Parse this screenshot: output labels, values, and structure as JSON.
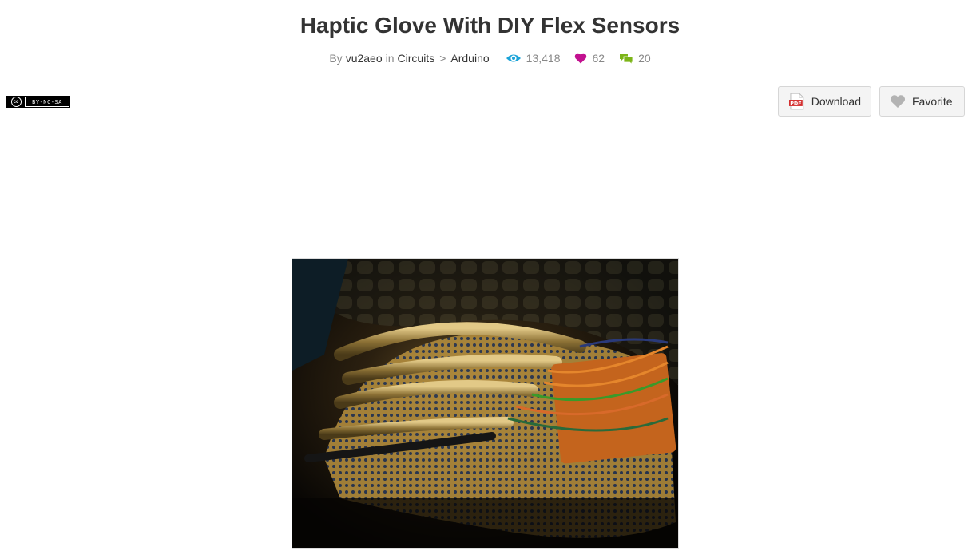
{
  "title": "Haptic Glove With DIY Flex Sensors",
  "meta": {
    "by_label": "By",
    "author": "vu2aeo",
    "in_label": "in",
    "category": "Circuits",
    "separator": ">",
    "subcategory": "Arduino",
    "views": "13,418",
    "favorites": "62",
    "comments": "20"
  },
  "license": {
    "badge": "cc",
    "terms": "BY-NC-SA"
  },
  "actions": {
    "download_label": "Download",
    "favorite_label": "Favorite",
    "pdf_badge": "PDF"
  },
  "hero_image": {
    "icon": "glove-photo"
  },
  "colors": {
    "views_icon": "#1ba3d8",
    "favorites_icon": "#c2118f",
    "comments_icon": "#7cb518",
    "pdf_red": "#d32f2f"
  }
}
